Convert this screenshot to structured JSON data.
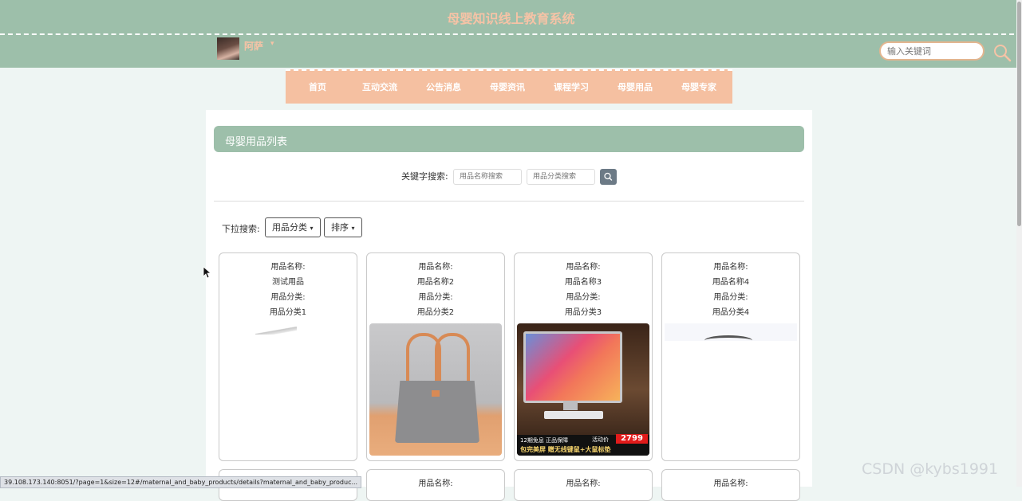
{
  "header": {
    "site_title": "母婴知识线上教育系统",
    "user_name": "阿萨",
    "user_caret": "▾",
    "search_placeholder": "输入关键词"
  },
  "nav": [
    "首页",
    "互动交流",
    "公告消息",
    "母婴资讯",
    "课程学习",
    "母婴用品",
    "母婴专家"
  ],
  "list": {
    "title": "母婴用品列表",
    "keyword_label": "关键字搜索:",
    "name_placeholder": "用品名称搜索",
    "category_placeholder": "用品分类搜索",
    "dropdown_label": "下拉搜索:",
    "dropdown_category": "用品分类",
    "dropdown_sort": "排序",
    "caret": "▾"
  },
  "products": [
    {
      "name_label": "用品名称:",
      "name": "测试用品",
      "category_label": "用品分类:",
      "category": "用品分类1",
      "image": "broken-image"
    },
    {
      "name_label": "用品名称:",
      "name": "用品名称2",
      "category_label": "用品分类:",
      "category": "用品分类2",
      "image": "grey-tote-bag"
    },
    {
      "name_label": "用品名称:",
      "name": "用品名称3",
      "category_label": "用品分类:",
      "category": "用品分类3",
      "image": "desktop-computer"
    },
    {
      "name_label": "用品名称:",
      "name": "用品名称4",
      "category_label": "用品分类:",
      "category": "用品分类4",
      "image": "partial-image"
    }
  ],
  "products_row2": [
    {
      "name_label": ""
    },
    {
      "name_label": "用品名称:"
    },
    {
      "name_label": "用品名称:"
    },
    {
      "name_label": "用品名称:"
    }
  ],
  "pc_banner": {
    "text1": "12期免息 正品保障",
    "price_label": "活动价",
    "price": "2799",
    "text2": "包完美屏  赠无线键鼠+大鼠标垫"
  },
  "status_url": "39.108.173.140:8051/?page=1&size=12#/maternal_and_baby_products/details?maternal_and_baby_produc...",
  "watermark": "CSDN @kybs1991",
  "colors": {
    "header_bg": "#9dbfaa",
    "accent": "#f5c0a1",
    "page_bg": "#eef5f3"
  }
}
